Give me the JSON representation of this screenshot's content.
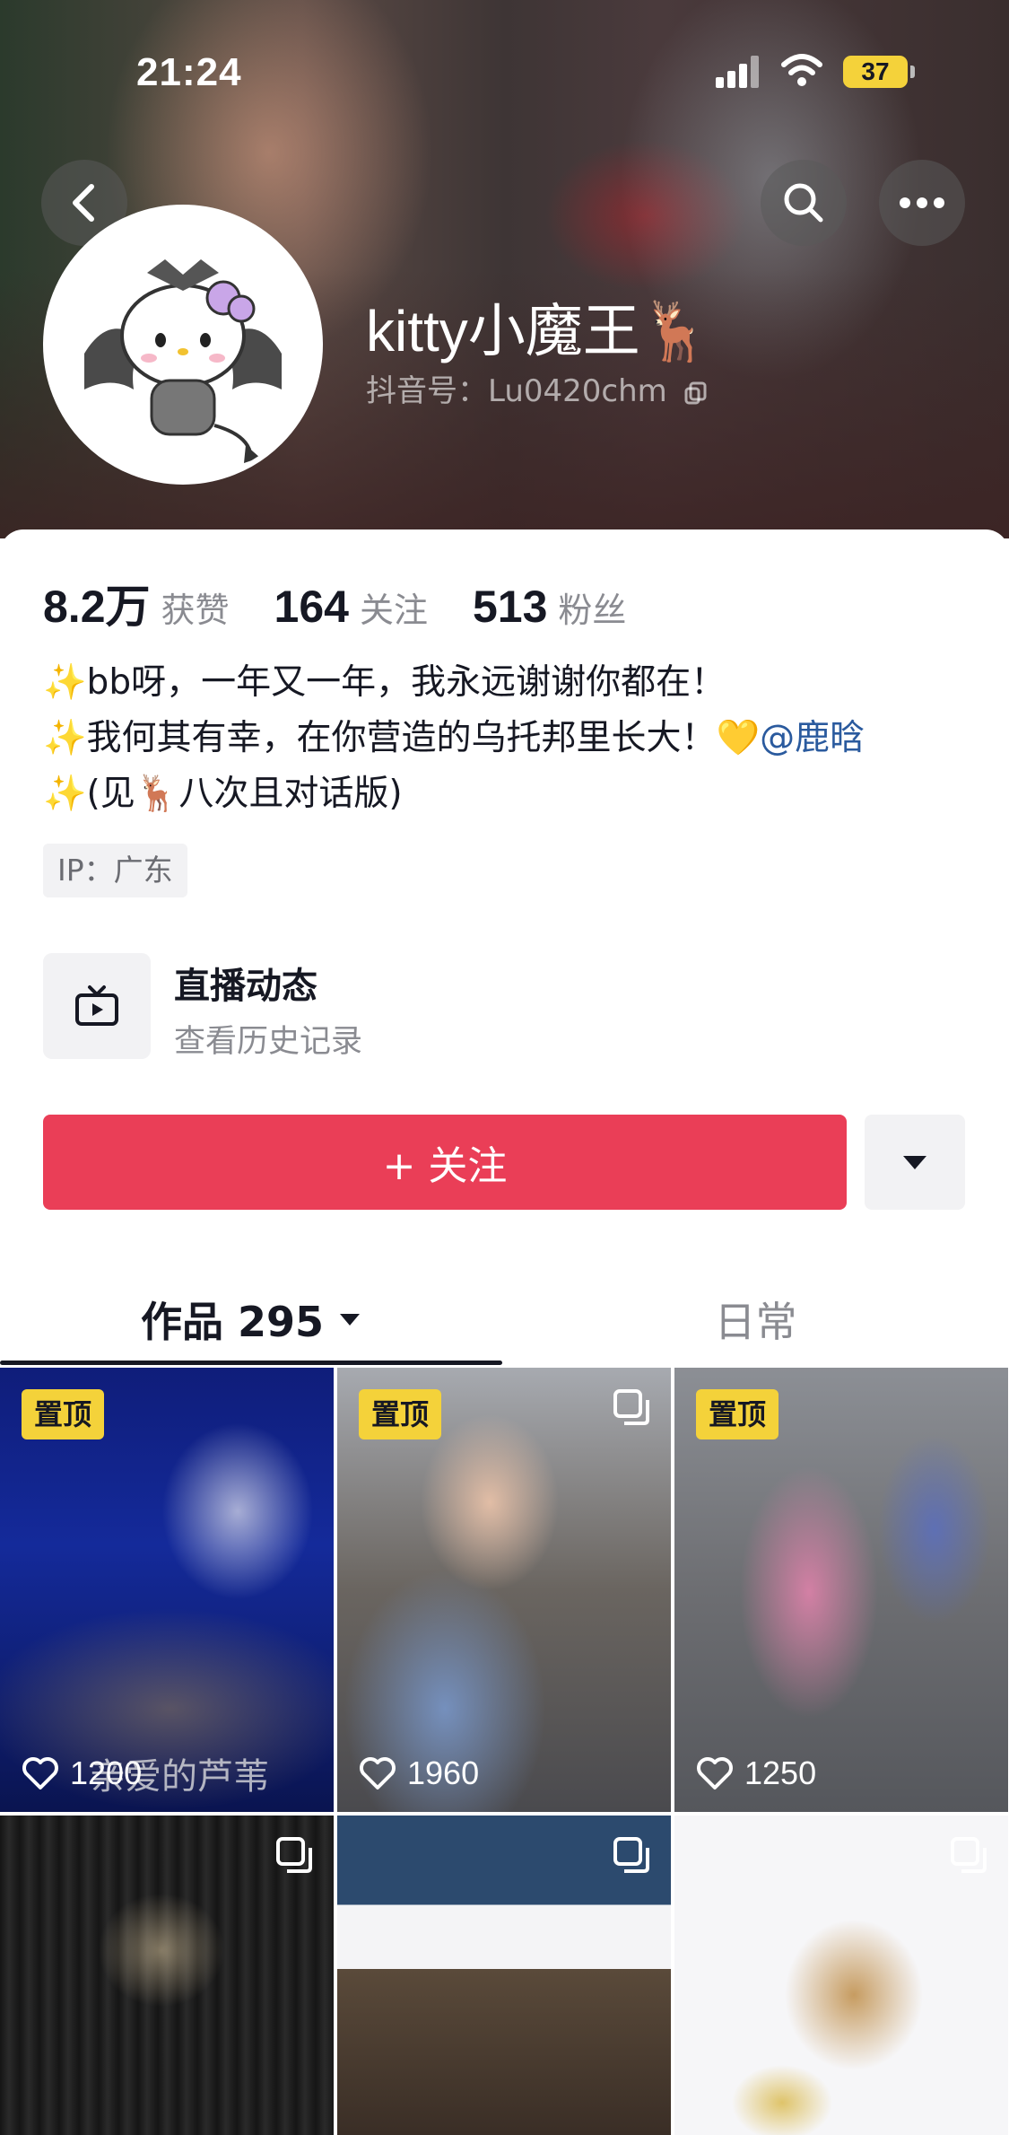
{
  "status_bar": {
    "time": "21:24",
    "battery": "37"
  },
  "profile": {
    "nickname": "kitty小魔王🦌",
    "douyin_id": "抖音号：Lu0420chm"
  },
  "stats": [
    {
      "value": "8.2万",
      "label": "获赞"
    },
    {
      "value": "164",
      "label": "关注"
    },
    {
      "value": "513",
      "label": "粉丝"
    }
  ],
  "bio": {
    "line1": "✨bb呀，一年又一年，我永远谢谢你都在！",
    "line2": "✨我何其有幸，在你营造的乌托邦里长大！💛",
    "mention": "@鹿晗",
    "line3": "✨(见🦌八次且对话版)"
  },
  "ip_tag": "IP：广东",
  "live": {
    "title": "直播动态",
    "subtitle": "查看历史记录"
  },
  "buttons": {
    "follow": "+ 关注"
  },
  "tabs": {
    "works": "作品 295",
    "daily": "日常"
  },
  "videos": [
    {
      "pinned": "置顶",
      "likes": "1200",
      "caption": "亲爱的芦苇"
    },
    {
      "pinned": "置顶",
      "likes": "1960"
    },
    {
      "pinned": "置顶",
      "likes": "1250"
    },
    {
      "likes": ""
    },
    {
      "likes": ""
    },
    {
      "likes": ""
    }
  ],
  "icons": [
    "back-arrow-icon",
    "search-icon",
    "more-dots-icon",
    "copy-icon",
    "tv-icon",
    "caret-down-icon",
    "heart-icon",
    "multi-image-icon"
  ]
}
